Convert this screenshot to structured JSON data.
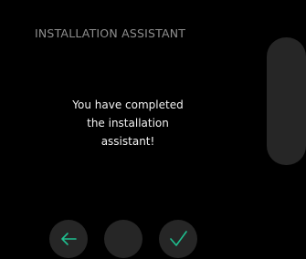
{
  "header": {
    "title": "INSTALLATION ASSISTANT"
  },
  "message": {
    "lines": [
      "You have completed",
      "the installation",
      "assistant!"
    ]
  },
  "buttons": {
    "back": {
      "icon": "arrow-left-icon"
    },
    "middle": {
      "icon": ""
    },
    "confirm": {
      "icon": "checkmark-icon"
    }
  },
  "colors": {
    "background": "#000000",
    "title_text": "#8e8e8e",
    "message_text": "#f2f2f2",
    "control_surface": "#262626",
    "accent": "#1fbf8f"
  }
}
